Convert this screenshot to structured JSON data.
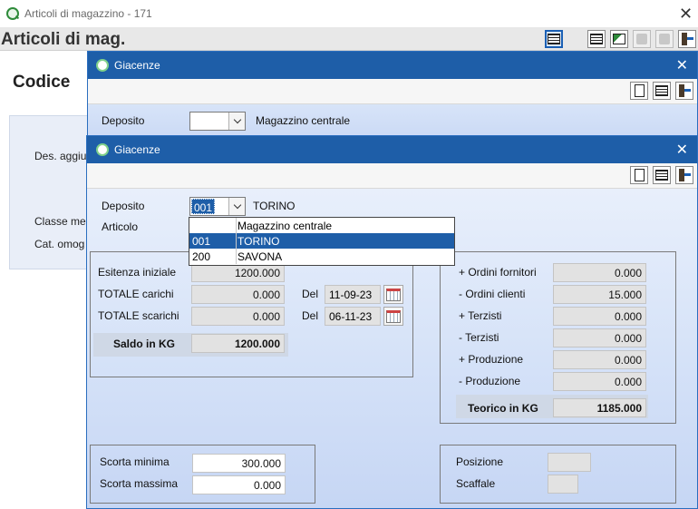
{
  "main_window": {
    "title": "Articoli di magazzino - 171",
    "heading": "Articoli di mag.",
    "code_label": "Codice",
    "labels": [
      "Des. aggiu",
      "Classe me",
      "Cat. omog"
    ]
  },
  "dialog_back": {
    "title": "Giacenze",
    "deposito_label": "Deposito",
    "deposito_code": "",
    "deposito_name": "Magazzino centrale"
  },
  "dialog": {
    "title": "Giacenze",
    "deposito_label": "Deposito",
    "deposito_code": "001",
    "deposito_name": "TORINO",
    "articolo_label": "Articolo",
    "dropdown": [
      {
        "code": "",
        "name": "Magazzino centrale"
      },
      {
        "code": "001",
        "name": "TORINO"
      },
      {
        "code": "200",
        "name": "SAVONA"
      }
    ],
    "left_group": {
      "esistenza_label": "Esitenza iniziale",
      "esistenza_value": "1200.000",
      "carichi_label": "TOTALE carichi",
      "carichi_value": "0.000",
      "carichi_del_label": "Del",
      "carichi_date": "11-09-23",
      "scarichi_label": "TOTALE scarichi",
      "scarichi_value": "0.000",
      "scarichi_del_label": "Del",
      "scarichi_date": "06-11-23",
      "saldo_label": "Saldo in KG",
      "saldo_value": "1200.000"
    },
    "right_group": {
      "rows": [
        {
          "label": "+ Ordini fornitori",
          "value": "0.000"
        },
        {
          "label": "- Ordini clienti",
          "value": "15.000"
        },
        {
          "label": "+ Terzisti",
          "value": "0.000"
        },
        {
          "label": "- Terzisti",
          "value": "0.000"
        },
        {
          "label": "+ Produzione",
          "value": "0.000"
        },
        {
          "label": "- Produzione",
          "value": "0.000"
        }
      ],
      "teorico_label": "Teorico in KG",
      "teorico_value": "1185.000"
    },
    "scorte": {
      "minima_label": "Scorta minima",
      "minima_value": "300.000",
      "massima_label": "Scorta massima",
      "massima_value": "0.000"
    },
    "location": {
      "posizione_label": "Posizione",
      "posizione_value": "",
      "scaffale_label": "Scaffale",
      "scaffale_value": ""
    }
  },
  "colors": {
    "title_bar": "#1e5ea8",
    "dialog_bg": "#d5e2f8",
    "selection": "#1e5ea8"
  },
  "icons": [
    "app-logo-icon",
    "grid-icon",
    "new-document-icon",
    "exit-icon",
    "calendar-icon",
    "chevron-down-icon",
    "close-icon"
  ]
}
